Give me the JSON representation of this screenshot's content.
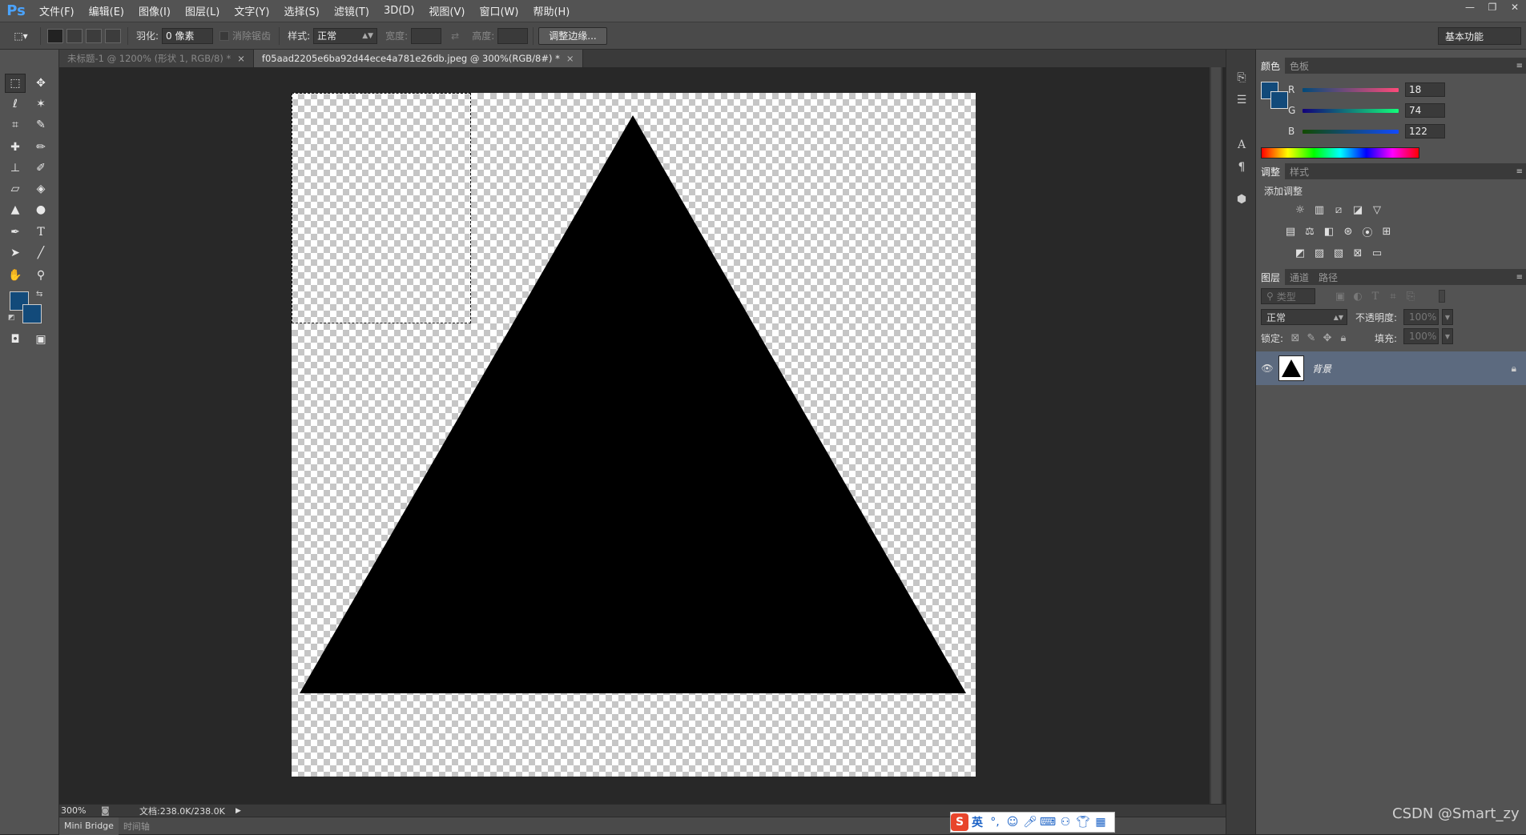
{
  "app": {
    "logo": "Ps"
  },
  "menu": [
    "文件(F)",
    "编辑(E)",
    "图像(I)",
    "图层(L)",
    "文字(Y)",
    "选择(S)",
    "滤镜(T)",
    "3D(D)",
    "视图(V)",
    "窗口(W)",
    "帮助(H)"
  ],
  "window_controls": [
    "—",
    "❐",
    "✕"
  ],
  "options": {
    "feather_label": "羽化:",
    "feather_value": "0 像素",
    "antialias_label": "消除锯齿",
    "style_label": "样式:",
    "style_value": "正常",
    "width_label": "宽度:",
    "height_label": "高度:",
    "refine_button": "调整边缘...",
    "workspace": "基本功能"
  },
  "doc_tabs": [
    {
      "label": "未标题-1 @ 1200% (形状 1, RGB/8) *",
      "active": false
    },
    {
      "label": "f05aad2205e6ba92d44ece4a781e26db.jpeg @ 300%(RGB/8#) *",
      "active": true
    }
  ],
  "status": {
    "zoom": "300%",
    "doc_info": "文档:238.0K/238.0K"
  },
  "bottom_tabs": [
    "Mini Bridge",
    "时间轴"
  ],
  "color_panel": {
    "tabs": [
      "颜色",
      "色板"
    ],
    "r_label": "R",
    "r_value": "18",
    "g_label": "G",
    "g_value": "74",
    "b_label": "B",
    "b_value": "122",
    "foreground": "#124a7a"
  },
  "adjust_panel": {
    "tabs": [
      "调整",
      "样式"
    ],
    "title": "添加调整"
  },
  "layers_panel": {
    "tabs": [
      "图层",
      "通道",
      "路径"
    ],
    "filter_kind": "类型",
    "blend_mode": "正常",
    "opacity_label": "不透明度:",
    "opacity_value": "100%",
    "lock_label": "锁定:",
    "fill_label": "填充:",
    "fill_value": "100%",
    "layer_name": "背景"
  },
  "ime": {
    "lang": "英",
    "logo": "S"
  },
  "watermark": "CSDN @Smart_zy"
}
